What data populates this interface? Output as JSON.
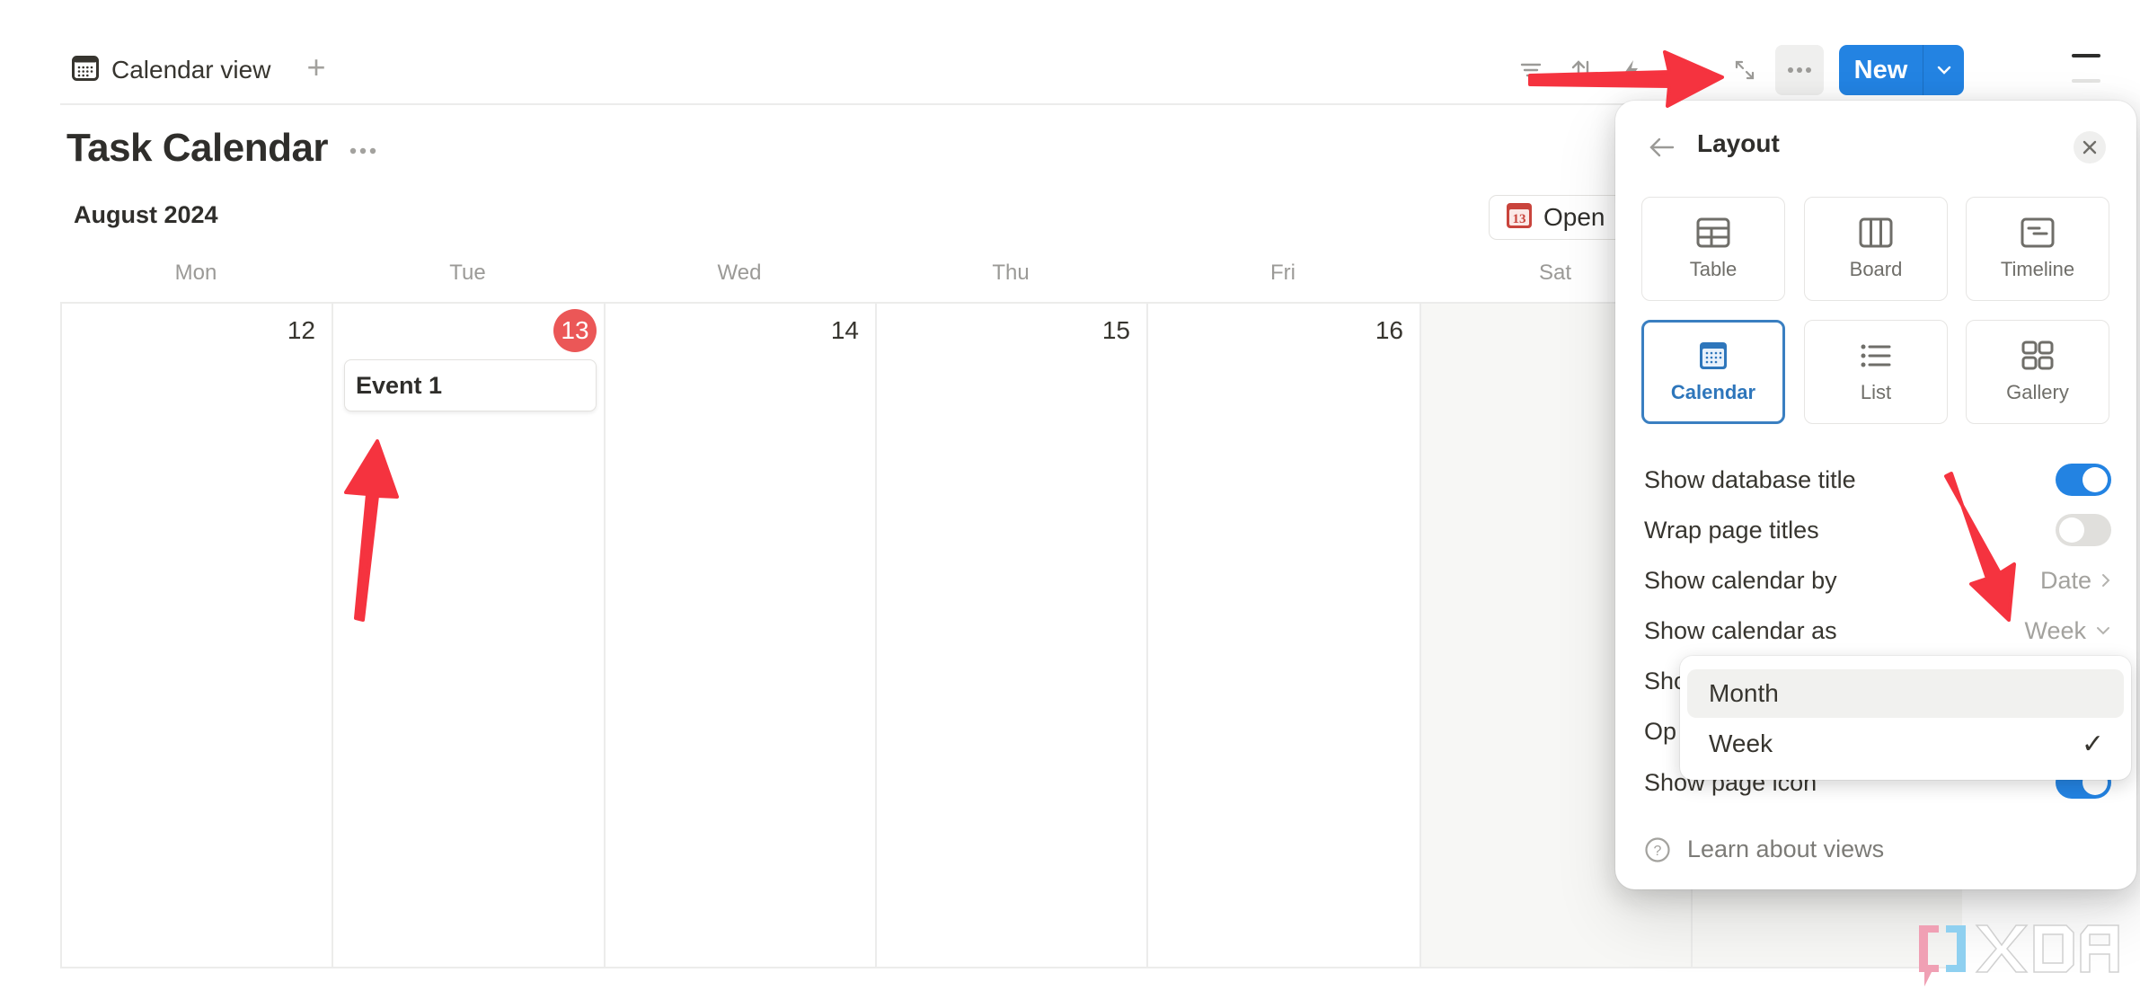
{
  "tabs": [
    {
      "label": "Calendar view",
      "icon": "calendar-icon",
      "active": true
    }
  ],
  "tab_add_label": "+",
  "toolbar": {
    "icons": [
      "filter-icon",
      "sort-icon",
      "lightning-icon",
      "search-icon",
      "expand-icon"
    ],
    "more_icon": "more-horizontal-icon",
    "new_label": "New",
    "new_caret_icon": "chevron-down-icon"
  },
  "page": {
    "title": "Task Calendar",
    "month_label": "August 2024",
    "open_button_label": "Open",
    "open_button_icon_text": "13"
  },
  "calendar": {
    "view": "Week",
    "days": [
      {
        "name": "Mon",
        "date": "12",
        "today": false,
        "weekend": false,
        "events": []
      },
      {
        "name": "Tue",
        "date": "13",
        "today": true,
        "weekend": false,
        "events": [
          "Event 1"
        ]
      },
      {
        "name": "Wed",
        "date": "14",
        "today": false,
        "weekend": false,
        "events": []
      },
      {
        "name": "Thu",
        "date": "15",
        "today": false,
        "weekend": false,
        "events": []
      },
      {
        "name": "Fri",
        "date": "16",
        "today": false,
        "weekend": false,
        "events": []
      },
      {
        "name": "Sat",
        "date": "",
        "today": false,
        "weekend": true,
        "events": []
      },
      {
        "name": "",
        "date": "",
        "today": false,
        "weekend": true,
        "events": []
      }
    ]
  },
  "layout_panel": {
    "title": "Layout",
    "layouts": [
      {
        "label": "Table",
        "icon": "table-icon",
        "selected": false
      },
      {
        "label": "Board",
        "icon": "board-icon",
        "selected": false
      },
      {
        "label": "Timeline",
        "icon": "timeline-icon",
        "selected": false
      },
      {
        "label": "Calendar",
        "icon": "calendar-icon",
        "selected": true
      },
      {
        "label": "List",
        "icon": "list-icon",
        "selected": false
      },
      {
        "label": "Gallery",
        "icon": "gallery-icon",
        "selected": false
      }
    ],
    "settings": [
      {
        "label": "Show database title",
        "type": "toggle",
        "on": true
      },
      {
        "label": "Wrap page titles",
        "type": "toggle",
        "on": false
      },
      {
        "label": "Show calendar by",
        "type": "link",
        "value": "Date"
      },
      {
        "label": "Show calendar as",
        "type": "select",
        "value": "Week"
      },
      {
        "label": "Sho",
        "type": "hidden",
        "value": ""
      },
      {
        "label": "Op",
        "type": "hidden",
        "value": ""
      },
      {
        "label": "Show page icon",
        "type": "toggle",
        "on": true
      }
    ],
    "learn_label": "Learn about views",
    "dropdown_options": [
      {
        "label": "Month",
        "checked": false,
        "hovered": true
      },
      {
        "label": "Week",
        "checked": true,
        "hovered": false
      }
    ],
    "check_mark": "✓"
  },
  "colors": {
    "accent": "#2383e2",
    "today": "#eb5757",
    "selected_layout": "#3a7fc1",
    "annotation": "#f5333f",
    "weekend_bg": "#f7f7f5"
  },
  "watermark": "XDA"
}
